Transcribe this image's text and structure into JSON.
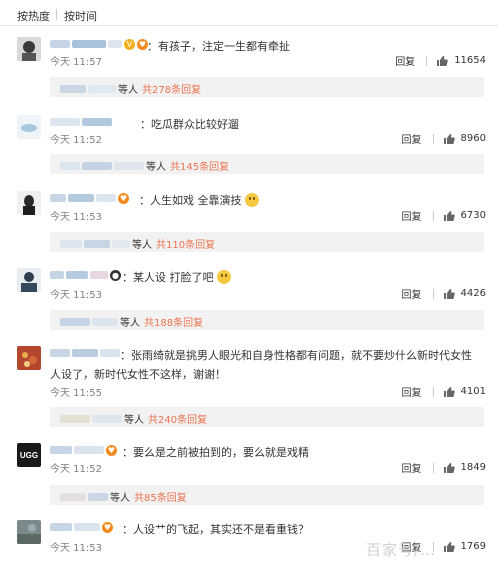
{
  "sort": {
    "hot": "按热度",
    "time": "按时间"
  },
  "labels": {
    "reply": "回复",
    "people_suffix": "等人"
  },
  "comments": [
    {
      "text": "：有孩子，注定一生都有牵扯",
      "time": "今天 11:57",
      "likes": "11654",
      "reply_summary": "共278条回复"
    },
    {
      "text": "：吃瓜群众比较好遛",
      "time": "今天 11:52",
      "likes": "8960",
      "reply_summary": "共145条回复"
    },
    {
      "text": "：人生如戏 全靠演技",
      "time": "今天 11:53",
      "likes": "6730",
      "reply_summary": "共110条回复"
    },
    {
      "text": "：某人设 打脸了吧",
      "time": "今天 11:53",
      "likes": "4426",
      "reply_summary": "共188条回复"
    },
    {
      "text": "：张雨绮就是挑男人眼光和自身性格都有问题，就不要炒什么新时代女性人设了，新时代女性不这样，谢谢！",
      "time": "今天 11:55",
      "likes": "4101",
      "reply_summary": "共240条回复"
    },
    {
      "text": "：要么是之前被拍到的，要么就是戏精",
      "time": "今天 11:52",
      "likes": "1849",
      "reply_summary": "共85条回复"
    },
    {
      "text": "：人设艹的飞起，其实还不是看重钱？",
      "time": "今天 11:53",
      "likes": "1769"
    }
  ],
  "avatars": {
    "6": "UGG"
  },
  "watermark": "百家号/…",
  "colors": {
    "accent": "#eb7350",
    "replybox": "#f2f2f2",
    "time": "#808080"
  }
}
